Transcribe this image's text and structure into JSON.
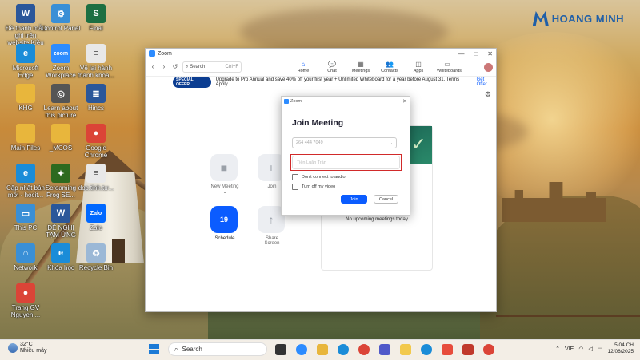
{
  "brand": {
    "logo_text": "HOANG MINH"
  },
  "desktop_icons": [
    {
      "label": "Đề thành mẫu ghi trên website Kiều Trinh",
      "icon": "word-doc-icon",
      "color": "#2b579a",
      "glyph": "W"
    },
    {
      "label": "Control Panel",
      "icon": "control-panel-icon",
      "color": "#3a8fd6",
      "glyph": "⚙"
    },
    {
      "label": "Final",
      "icon": "excel-icon",
      "color": "#1d6f42",
      "glyph": "S"
    },
    {
      "label": "Microsoft Edge",
      "icon": "edge-icon",
      "color": "#1a8cd8",
      "glyph": "e"
    },
    {
      "label": "Zoom Workplace",
      "icon": "zoom-icon",
      "color": "#2d8cff",
      "glyph": "zoom"
    },
    {
      "label": "Về lại hành thành khóa...",
      "icon": "document-icon",
      "color": "#e8e8e8",
      "glyph": "≡"
    },
    {
      "label": "KHG",
      "icon": "folder-icon",
      "color": "#e8b63c",
      "glyph": ""
    },
    {
      "label": "Learn about this picture",
      "icon": "camera-icon",
      "color": "#555",
      "glyph": "◎"
    },
    {
      "label": "Hincs",
      "icon": "notes-icon",
      "color": "#2b579a",
      "glyph": "≣"
    },
    {
      "label": "Main Files",
      "icon": "folder-icon",
      "color": "#e8b63c",
      "glyph": ""
    },
    {
      "label": "_MCOS",
      "icon": "folder-icon",
      "color": "#e8b63c",
      "glyph": ""
    },
    {
      "label": "Google Chrome",
      "icon": "chrome-icon",
      "color": "#db4437",
      "glyph": "●"
    },
    {
      "label": "Cập nhật bản mới - hocit...",
      "icon": "edge-icon",
      "color": "#1a8cd8",
      "glyph": "e"
    },
    {
      "label": "Screaming Frog SE...",
      "icon": "frog-icon",
      "color": "#2d6a1f",
      "glyph": "✦"
    },
    {
      "label": "doc.tinh.tư...",
      "icon": "document-icon",
      "color": "#e8e8e8",
      "glyph": "≡"
    },
    {
      "label": "This PC",
      "icon": "monitor-icon",
      "color": "#3a8fd6",
      "glyph": "▭"
    },
    {
      "label": "ĐỀ NGHỊ TẠM ỨNG",
      "icon": "word-doc-icon",
      "color": "#2b579a",
      "glyph": "W"
    },
    {
      "label": "Zalo",
      "icon": "zalo-icon",
      "color": "#0068ff",
      "glyph": "Zalo"
    },
    {
      "label": "Network",
      "icon": "network-icon",
      "color": "#3a8fd6",
      "glyph": "⌂"
    },
    {
      "label": "Khóa học",
      "icon": "edge-icon",
      "color": "#1a8cd8",
      "glyph": "e"
    },
    {
      "label": "Recycle Bin",
      "icon": "recycle-bin-icon",
      "color": "#9bb8d6",
      "glyph": "♻"
    },
    {
      "label": "Trang GV Nguyen ...",
      "icon": "chrome-icon",
      "color": "#db4437",
      "glyph": "●"
    }
  ],
  "zoom": {
    "window_title": "Zoom",
    "search_label": "Search",
    "search_shortcut": "Ctrl+F",
    "tabs": [
      {
        "label": "Home",
        "icon": "home-icon",
        "glyph": "⌂",
        "active": true
      },
      {
        "label": "Chat",
        "icon": "chat-icon",
        "glyph": "💬",
        "active": false
      },
      {
        "label": "Meetings",
        "icon": "meetings-icon",
        "glyph": "▦",
        "active": false
      },
      {
        "label": "Contacts",
        "icon": "contacts-icon",
        "glyph": "👥",
        "active": false
      },
      {
        "label": "Apps",
        "icon": "apps-icon",
        "glyph": "◫",
        "active": false
      },
      {
        "label": "Whiteboards",
        "icon": "whiteboard-icon",
        "glyph": "▭",
        "active": false
      }
    ],
    "offer_badge": "SPECIAL OFFER",
    "offer_text": "Upgrade to Pro Annual and save 40% off your first year + Unlimited Whiteboard for a year before August 31. Terms Apply.",
    "offer_link": "Get Offer",
    "home_buttons": {
      "new_meeting": "New Meeting ⌄",
      "join": "Join",
      "schedule": "Schedule",
      "schedule_day": "19",
      "share_screen": "Share Screen"
    },
    "no_meetings": "No upcoming meetings today"
  },
  "dialog": {
    "title": "Zoom",
    "heading": "Join Meeting",
    "meeting_id_placeholder": "264 444 7049",
    "name_placeholder": "Tiên Luân Trần",
    "dont_connect_audio": "Don't connect to audio",
    "turn_off_video": "Turn off my video",
    "join_label": "Join",
    "cancel_label": "Cancel"
  },
  "taskbar": {
    "temperature": "32°C",
    "weather": "Nhiều mây",
    "search_label": "Search",
    "language": "VIE",
    "time": "5:04 CH",
    "date": "12/06/2025"
  }
}
